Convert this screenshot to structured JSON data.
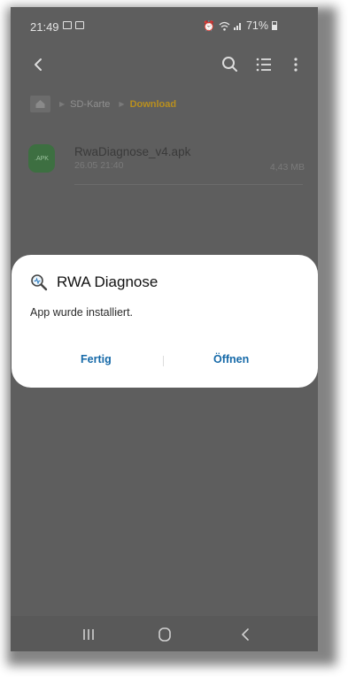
{
  "status_bar": {
    "time": "21:49",
    "battery_percent": "71%"
  },
  "breadcrumb": {
    "items": [
      "SD-Karte",
      "Download"
    ]
  },
  "file": {
    "type_label": ".APK",
    "name": "RwaDiagnose_v4.apk",
    "date": "26.05 21:40",
    "size": "4,43 MB"
  },
  "dialog": {
    "app_name": "RWA Diagnose",
    "message": "App wurde installiert.",
    "buttons": {
      "done": "Fertig",
      "open": "Öffnen"
    },
    "accent_color": "#1569a8"
  },
  "icons": [
    "gallery-icon",
    "alarm-icon",
    "wifi-icon",
    "signal-icon",
    "battery-icon",
    "back-arrow-icon",
    "search-icon",
    "list-view-icon",
    "more-options-icon",
    "home-folder-icon",
    "apk-file-icon",
    "magnifier-app-icon",
    "recent-apps-icon",
    "home-icon",
    "back-icon"
  ]
}
